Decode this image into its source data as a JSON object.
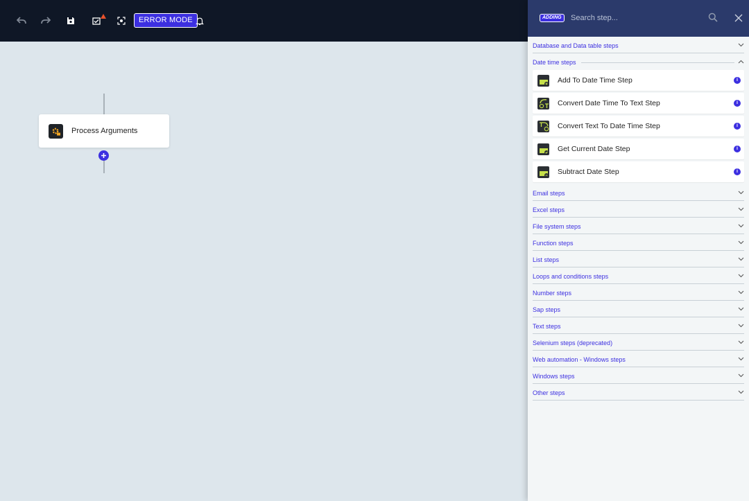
{
  "toolbar": {
    "error_mode_label": "ERROR MODE"
  },
  "flow": {
    "node_label": "Process Arguments",
    "add_symbol": "+"
  },
  "panel": {
    "badge": "ADDING",
    "search_placeholder": "Search step...",
    "categories_before": [
      {
        "label": "Database and Data table steps"
      }
    ],
    "open_category": {
      "label": "Date time steps",
      "items": [
        {
          "label": "Add To Date Time Step"
        },
        {
          "label": "Convert Date Time To Text Step"
        },
        {
          "label": "Convert Text To Date Time Step"
        },
        {
          "label": "Get Current Date Step"
        },
        {
          "label": "Subtract Date Step"
        }
      ]
    },
    "categories_after": [
      {
        "label": "Email steps"
      },
      {
        "label": "Excel steps"
      },
      {
        "label": "File system steps"
      },
      {
        "label": "Function steps"
      },
      {
        "label": "List steps"
      },
      {
        "label": "Loops and conditions steps"
      },
      {
        "label": "Number steps"
      },
      {
        "label": "Sap steps"
      },
      {
        "label": "Text steps"
      },
      {
        "label": "Selenium steps (deprecated)"
      },
      {
        "label": "Web automation - Windows steps"
      },
      {
        "label": "Windows steps"
      },
      {
        "label": "Other steps"
      }
    ]
  },
  "colors": {
    "accent": "#3c2fe0",
    "toolbar_bg": "#0f1726",
    "panel_header_bg": "#2b3a6b",
    "canvas_bg": "#dde6ec",
    "icon_green": "#c6e04a"
  },
  "icons": [
    "undo-icon",
    "redo-icon",
    "save-icon",
    "checklist-warning-icon",
    "focus-icon",
    "bell-icon",
    "search-icon",
    "close-icon",
    "chevron-down-icon",
    "chevron-up-icon",
    "info-icon"
  ]
}
